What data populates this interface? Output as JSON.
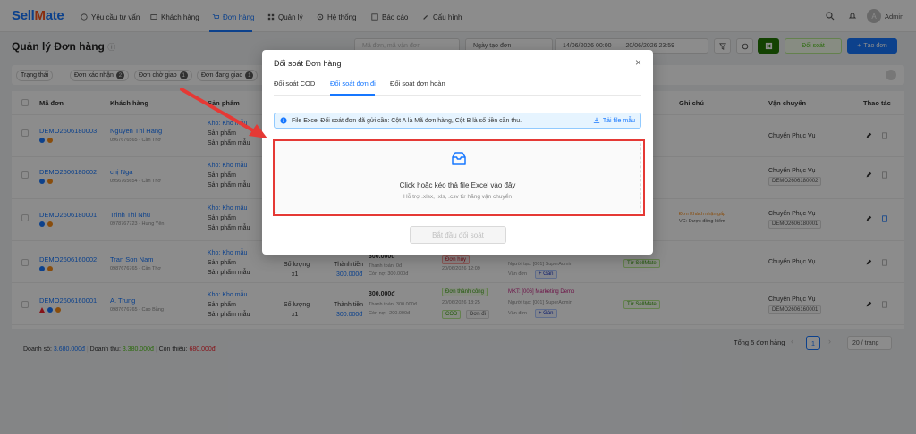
{
  "nav": {
    "logo_a": "Sell",
    "logo_b": "M",
    "logo_c": "ate",
    "items": [
      "Yêu cầu tư vấn",
      "Khách hàng",
      "Đơn hàng",
      "Quản lý",
      "Hệ thống",
      "Báo cáo",
      "Cấu hình"
    ],
    "user": "Admin",
    "avatar_letter": "A"
  },
  "page": {
    "title": "Quản lý Đơn hàng",
    "search_placeholder": "Mã đơn, mã vận đơn",
    "date_type": "Ngày tạo đơn",
    "date_from": "14/06/2026 00:00",
    "date_to": "20/06/2026 23:59",
    "sync_label": "Đối soát",
    "create_label": "Tạo đơn"
  },
  "filters": [
    {
      "label": "Trạng thái",
      "count": ""
    },
    {
      "label": "Đơn xác nhận",
      "count": "2"
    },
    {
      "label": "Đơn chờ giao",
      "count": "1"
    },
    {
      "label": "Đơn đang giao",
      "count": "1"
    }
  ],
  "table": {
    "headers": [
      "Mã đơn",
      "Khách hàng",
      "Sản phẩm",
      "Ghi chú",
      "Vận chuyển",
      "Thao tác"
    ],
    "rows": [
      {
        "code": "DEMO2606180003",
        "name": "Nguyen Thi Hang",
        "phone": "0967676565 - Cần Thơ",
        "stock": "Kho: Kho mẫu",
        "p1": "Sản phẩm",
        "p2": "Sản phẩm mẫu",
        "status": "",
        "note": "",
        "ship": "Chuyển Phục Vụ",
        "ship_code": ""
      },
      {
        "code": "DEMO2606180002",
        "name": "chị Nga",
        "phone": "0956765654 - Cần Thơ",
        "stock": "Kho: Kho mẫu",
        "p1": "Sản phẩm",
        "p2": "Sản phẩm mẫu",
        "status": "",
        "note": "",
        "ship": "Chuyển Phục Vụ",
        "ship_code": "DEMO2606180002"
      },
      {
        "code": "DEMO2606180001",
        "name": "Trinh Thi Nhu",
        "phone": "0978767723 - Hưng Yên",
        "stock": "Kho: Kho mẫu",
        "p1": "Sản phẩm",
        "p2": "Sản phẩm mẫu",
        "status": "",
        "note": "Đơn Khách nhận gấp",
        "note2": "VC: Được đồng kiểm",
        "ship": "Chuyển Phục Vụ",
        "ship_code": "DEMO2606180001"
      },
      {
        "code": "DEMO2606160002",
        "name": "Tran Son Nam",
        "phone": "0987676765 - Cần Thơ",
        "stock": "Kho: Kho mẫu",
        "p1": "Sản phẩm",
        "p2": "Sản phẩm mẫu",
        "qty_label": "Số lượng",
        "qty": "x1",
        "total_label": "Thành tiền",
        "total": "300.000đ",
        "paid": "Thanh toán: 0đ",
        "remain": "Còn nợ: 300.000đ",
        "status": "Đơn hủy",
        "date": "20/06/2026 12:09",
        "creator": "Người tạo: [001] SuperAdmin",
        "waybill": "Vận đơn",
        "source": "Từ SellMate",
        "ship": "Chuyển Phục Vụ",
        "ship_code": ""
      },
      {
        "code": "DEMO2606160001",
        "name": "A. Trung",
        "phone": "0987676765 - Cao Bằng",
        "stock": "Kho: Kho mẫu",
        "p1": "Sản phẩm",
        "p2": "Sản phẩm mẫu",
        "qty_label": "Số lượng",
        "qty": "x1",
        "total_label": "Thành tiền",
        "total": "300.000đ",
        "amount": "300.000đ",
        "paid": "Thanh toán: 300.000đ",
        "remain": "Còn nợ: -200.000đ",
        "status": "Đơn thành công",
        "date": "20/06/2026 18:25",
        "creator": "Người tạo: [001] SuperAdmin",
        "mkt": "MKT: [006] Marketing Demo",
        "waybill": "Vận đơn",
        "source": "Từ SellMate",
        "ship": "Chuyển Phục Vụ",
        "ship_code": "DEMO2606160001"
      }
    ],
    "cancel_amount": "300.000đ",
    "cod": "COD",
    "gan": "+ Gán",
    "doi": "Đơn đi"
  },
  "footer": {
    "revenue_label": "Doanh số:",
    "revenue": "3.680.000đ",
    "income_label": "Doanh thu:",
    "income": "3.380.000đ",
    "missing_label": "Còn thiếu:",
    "missing": "680.000đ",
    "total": "Tổng 5 đơn hàng",
    "page": "1",
    "page_size": "20 / trang"
  },
  "modal": {
    "title": "Đối soát Đơn hàng",
    "tabs": [
      "Đối soát COD",
      "Đối soát đơn đi",
      "Đối soát đơn hoàn"
    ],
    "info": "File Excel Đối soát đơn đã gửi cần: Cột A là Mã đơn hàng, Cột B là số tiền cần thu.",
    "download": "Tải file mẫu",
    "drop_title": "Click hoặc kéo thả file Excel vào đây",
    "drop_hint": "Hỗ trợ .xlsx, .xls, .csv từ hãng vận chuyển",
    "start": "Bắt đầu đối soát"
  },
  "colors": {
    "accent": "#1677ff",
    "annotation": "#e53935",
    "success": "#52c41a"
  }
}
